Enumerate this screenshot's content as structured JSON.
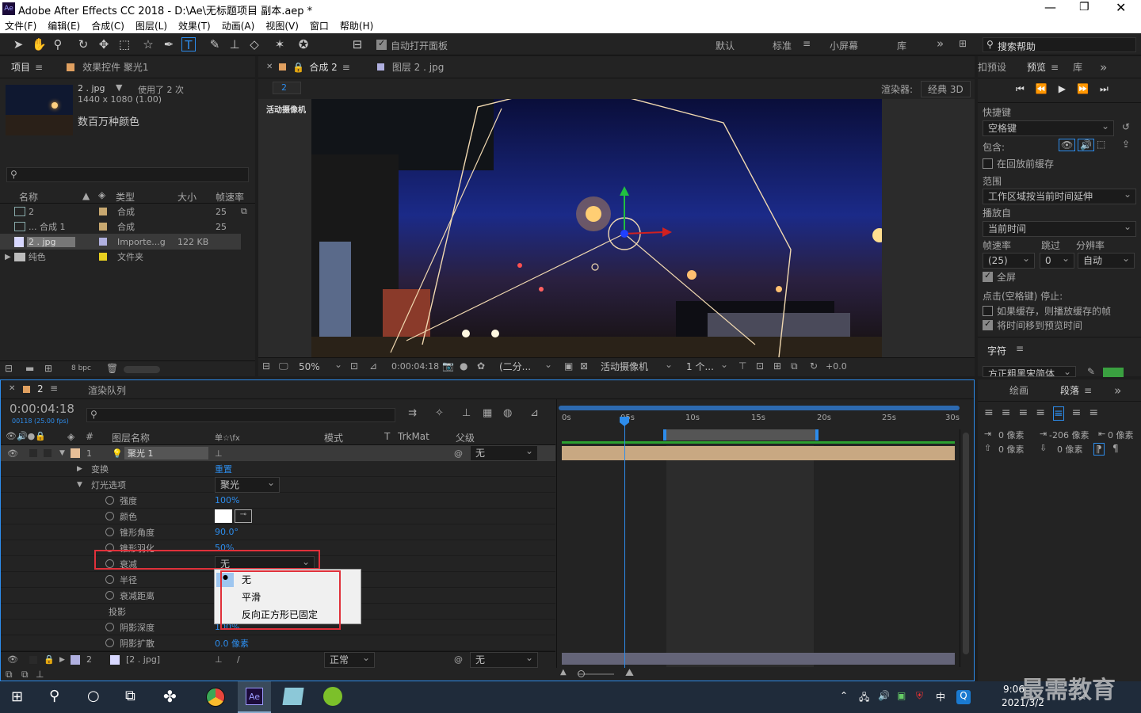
{
  "window": {
    "title": "Adobe After Effects CC 2018 - D:\\Ae\\无标题项目 副本.aep *"
  },
  "menu": [
    "文件(F)",
    "编辑(E)",
    "合成(C)",
    "图层(L)",
    "效果(T)",
    "动画(A)",
    "视图(V)",
    "窗口",
    "帮助(H)"
  ],
  "toolbar": {
    "auto_open": "自动打开面板",
    "workspaces": [
      "默认",
      "标准",
      "小屏幕",
      "库"
    ],
    "search_help": "搜索帮助"
  },
  "project": {
    "tab": "项目",
    "effects_tab": "效果控件 聚光1",
    "asset_name": "2 . jpg",
    "used": "使用了 2 次",
    "dims": "1440 x 1080 (1.00)",
    "colors": "数百万种颜色",
    "cols": [
      "名称",
      "类型",
      "大小",
      "帧速率"
    ],
    "items": [
      {
        "name": "2",
        "type": "合成",
        "size": "",
        "fps": "25"
      },
      {
        "name": "... 合成 1",
        "type": "合成",
        "size": "",
        "fps": "25"
      },
      {
        "name": "2 . jpg",
        "type": "Importe...g",
        "size": "122 KB",
        "fps": ""
      },
      {
        "name": "纯色",
        "type": "文件夹",
        "size": "",
        "fps": ""
      }
    ],
    "bpc": "8 bpc"
  },
  "comp": {
    "tab": "合成 2",
    "layer_tab": "图层 2 . jpg",
    "breadcrumb": "2",
    "renderer_label": "渲染器:",
    "renderer": "经典 3D",
    "camera_label": "活动摄像机",
    "zoom": "50%",
    "time": "0:00:04:18",
    "resolution": "(二分...",
    "view": "活动摄像机",
    "views": "1 个...",
    "exposure": "+0.0"
  },
  "preview": {
    "tab_presets": "扣预设",
    "tab": "预览",
    "tab_lib": "库",
    "shortcut_label": "快捷键",
    "shortcut": "空格键",
    "include": "包含:",
    "cache_before": "在回放前缓存",
    "range_label": "范围",
    "range": "工作区域按当前时间延伸",
    "play_from_label": "播放自",
    "play_from": "当前时间",
    "fps_label": "帧速率",
    "skip_label": "跳过",
    "res_label": "分辨率",
    "fps": "(25)",
    "skip": "0",
    "res": "自动",
    "fullscreen": "全屏",
    "click_stop": "点击(空格键) 停止:",
    "if_cache": "如果缓存，则播放缓存的帧",
    "move_time": "将时间移到预览时间",
    "char_tab": "字符",
    "font": "方正粗黑宋简体"
  },
  "paragraph": {
    "tab_paint": "绘画",
    "tab": "段落",
    "indent_left": "0 像素",
    "indent_first": "-206 像素",
    "indent_right": "0 像素",
    "space_before": "0 像素",
    "space_after": "0 像素"
  },
  "timeline": {
    "tab": "2",
    "render_queue": "渲染队列",
    "time": "0:00:04:18",
    "frames": "00118 (25.00 fps)",
    "cols": {
      "layer": "图层名称",
      "switches": "单☆\\fx",
      "mode": "模式",
      "t": "T",
      "trkmat": "TrkMat",
      "parent": "父级"
    },
    "layer1": {
      "num": "1",
      "name": "聚光 1",
      "parent": "无"
    },
    "props": [
      {
        "label": "变换",
        "value": "重置"
      },
      {
        "label": "灯光选项",
        "value": "聚光"
      },
      {
        "label": "强度",
        "value": "100%"
      },
      {
        "label": "颜色",
        "value": ""
      },
      {
        "label": "锥形角度",
        "value": "90.0°"
      },
      {
        "label": "锥形羽化",
        "value": "50%"
      },
      {
        "label": "衰减",
        "value": "无"
      },
      {
        "label": "半径",
        "value": ""
      },
      {
        "label": "衰减距离",
        "value": ""
      },
      {
        "label": "投影",
        "value": ""
      },
      {
        "label": "阴影深度",
        "value": "100%"
      },
      {
        "label": "阴影扩散",
        "value": "0.0 像素"
      }
    ],
    "layer2": {
      "num": "2",
      "name": "[2 . jpg]",
      "mode": "正常",
      "parent": "无"
    },
    "ruler": [
      "0s",
      "05s",
      "10s",
      "15s",
      "20s",
      "25s",
      "30s"
    ],
    "dropdown": [
      "无",
      "平滑",
      "反向正方形已固定"
    ]
  },
  "taskbar": {
    "time": "9:06",
    "date": "2021/3/2",
    "ime": "中",
    "watermark": "最需教育"
  }
}
